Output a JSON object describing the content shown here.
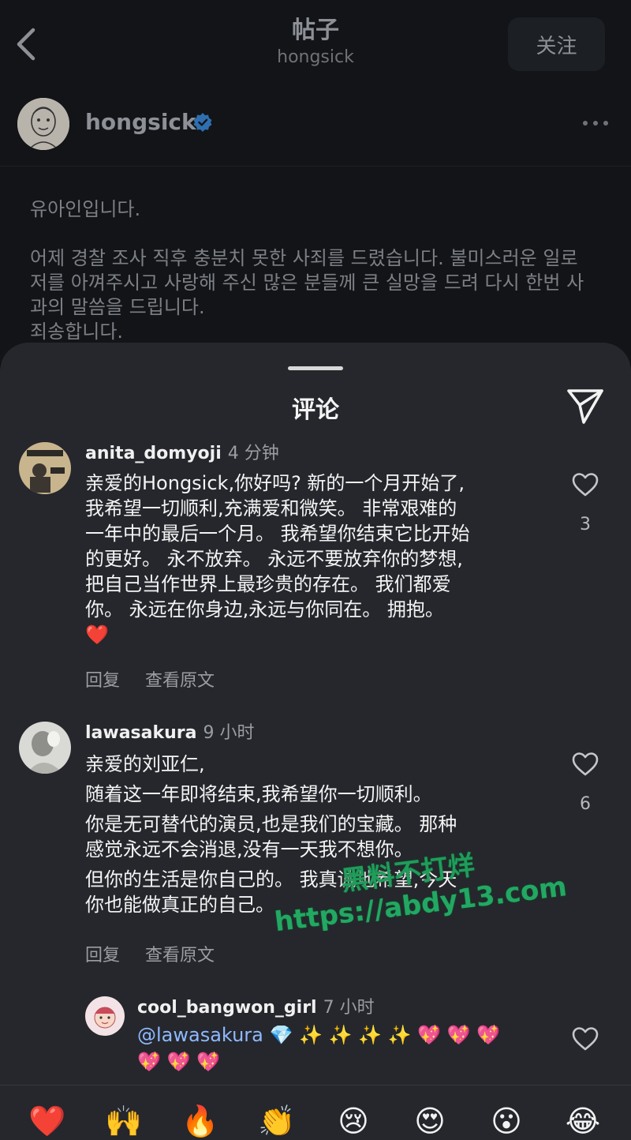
{
  "header": {
    "title": "帖子",
    "subtitle": "hongsick",
    "follow_label": "关注"
  },
  "author": {
    "name": "hongsick",
    "verified": true
  },
  "post": {
    "paragraphs": [
      "유아인입니다.",
      "어제 경찰 조사 직후 충분치 못한 사죄를 드렸습니다. 불미스러운 일로 저를 아껴주시고 사랑해 주신 많은 분들께 큰 실망을 드려 다시 한번 사과의 말씀을 드립니다.",
      "죄송합니다."
    ]
  },
  "comments_sheet": {
    "title": "评论",
    "comments": [
      {
        "user": "anita_domyoji",
        "time": "4 分钟",
        "lines": [
          "亲爱的Hongsick,你好吗? 新的一个月开始了,",
          "我希望一切顺利,充满爱和微笑。 非常艰难的",
          "一年中的最后一个月。 我希望你结束它比开始",
          "的更好。 永不放弃。 永远不要放弃你的梦想,",
          "把自己当作世界上最珍贵的存在。 我们都爱",
          "你。 永远在你身边,永远与你同在。 拥抱。",
          "❤️"
        ],
        "likes": "3",
        "reply_label": "回复",
        "view_original_label": "查看原文"
      },
      {
        "user": "lawasakura",
        "time": "9 小时",
        "lines": [
          "亲爱的刘亚仁,",
          "随着这一年即将结束,我希望你一切顺利。",
          "你是无可替代的演员,也是我们的宝藏。 那种",
          "感觉永远不会消退,没有一天我不想你。",
          "但你的生活是你自己的。 我真诚地希望,今天",
          "你也能做真正的自己。"
        ],
        "likes": "6",
        "reply_label": "回复",
        "view_original_label": "查看原文"
      }
    ],
    "reply": {
      "user": "cool_bangwon_girl",
      "time": "7 小时",
      "mention": "@lawasakura",
      "emoji_line1": " 💎 ✨ ✨ ✨ ✨ 💖 💖 💖",
      "emoji_line2": "💖 💖 💖"
    }
  },
  "watermark": {
    "line1": "黑料不打烊",
    "line2": "https://abdy13.com"
  },
  "emoji_bar": [
    "❤️",
    "🙌",
    "🔥",
    "👏",
    "😢",
    "😍",
    "😮",
    "😂"
  ],
  "colors": {
    "background": "#0b0d10",
    "sheet": "#25272c",
    "verified": "#3897f0",
    "like_heart": "#ff3040",
    "mention": "#8fb9ff",
    "watermark": "#1f9d5a"
  }
}
